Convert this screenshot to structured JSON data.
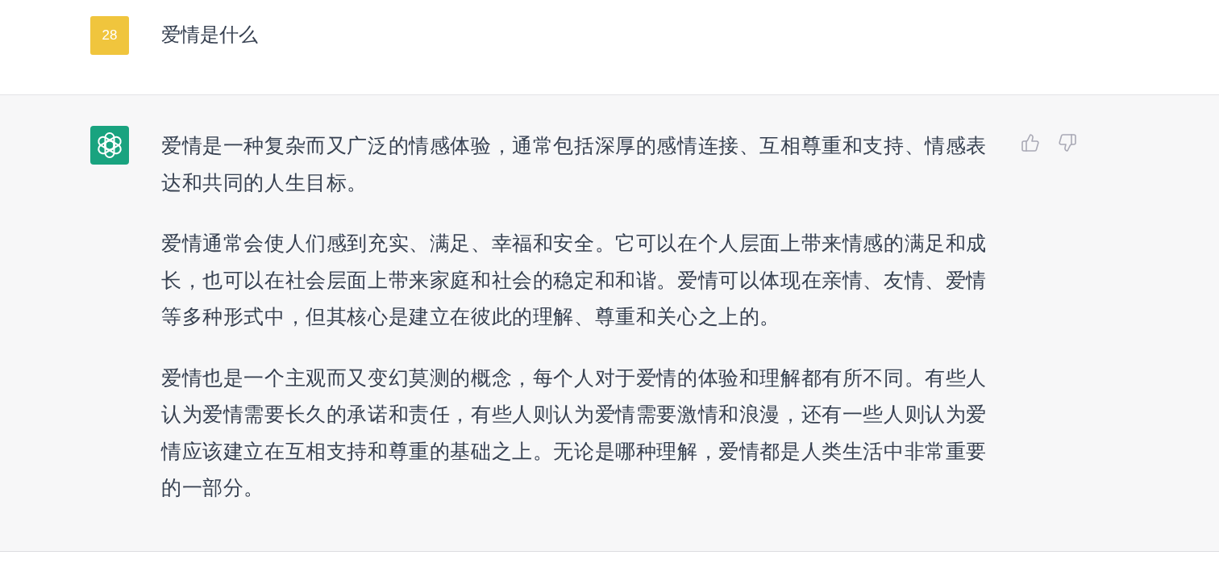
{
  "user_message": {
    "avatar": "28",
    "text": "爱情是什么"
  },
  "assistant_message": {
    "paragraphs": [
      "爱情是一种复杂而又广泛的情感体验，通常包括深厚的感情连接、互相尊重和支持、情感表达和共同的人生目标。",
      "爱情通常会使人们感到充实、满足、幸福和安全。它可以在个人层面上带来情感的满足和成长，也可以在社会层面上带来家庭和社会的稳定和和谐。爱情可以体现在亲情、友情、爱情等多种形式中，但其核心是建立在彼此的理解、尊重和关心之上的。",
      "爱情也是一个主观而又变幻莫测的概念，每个人对于爱情的体验和理解都有所不同。有些人认为爱情需要长久的承诺和责任，有些人则认为爱情需要激情和浪漫，还有一些人则认为爱情应该建立在互相支持和尊重的基础之上。无论是哪种理解，爱情都是人类生活中非常重要的一部分。"
    ]
  }
}
